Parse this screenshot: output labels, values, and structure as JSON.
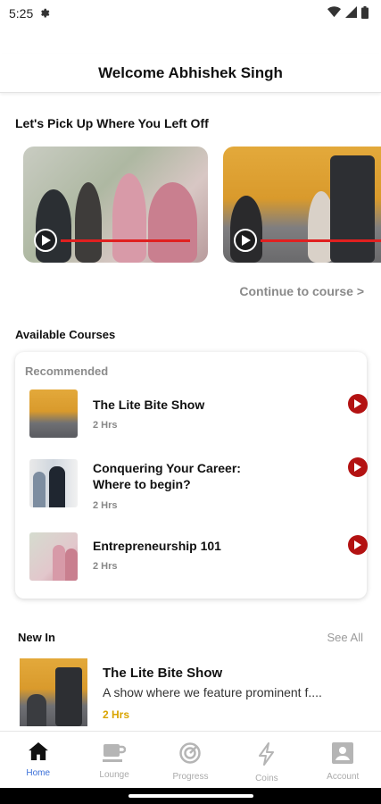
{
  "status_bar": {
    "time": "5:25",
    "icons": [
      "gear-icon",
      "wifi-icon",
      "signal-icon",
      "battery-icon"
    ]
  },
  "header": {
    "title": "Welcome Abhishek Singh"
  },
  "continue_section": {
    "title": "Let's Pick Up Where You Left Off",
    "link": "Continue to course >",
    "cards": [
      {
        "progress": 0.8
      },
      {
        "progress": 0.75
      }
    ]
  },
  "available": {
    "title": "Available Courses",
    "recommended_label": "Recommended",
    "items": [
      {
        "title": "The Lite Bite Show",
        "duration": "2 Hrs"
      },
      {
        "title": "Conquering Your Career: Where to begin?",
        "duration": "2 Hrs"
      },
      {
        "title": "Entrepreneurship 101",
        "duration": "2 Hrs"
      }
    ]
  },
  "new_in": {
    "title": "New In",
    "see_all": "See All",
    "item": {
      "title": "The Lite Bite Show",
      "description": "A show where we feature prominent f....",
      "duration": "2 Hrs"
    }
  },
  "nav": [
    {
      "label": "Home",
      "icon": "home-icon",
      "active": true
    },
    {
      "label": "Lounge",
      "icon": "coffee-icon",
      "active": false
    },
    {
      "label": "Progress",
      "icon": "target-icon",
      "active": false
    },
    {
      "label": "Coins",
      "icon": "lightning-icon",
      "active": false
    },
    {
      "label": "Account",
      "icon": "account-icon",
      "active": false
    }
  ],
  "colors": {
    "accent_red": "#b31212",
    "active_nav": "#3a6fd8",
    "duration_gold": "#d9a400"
  }
}
